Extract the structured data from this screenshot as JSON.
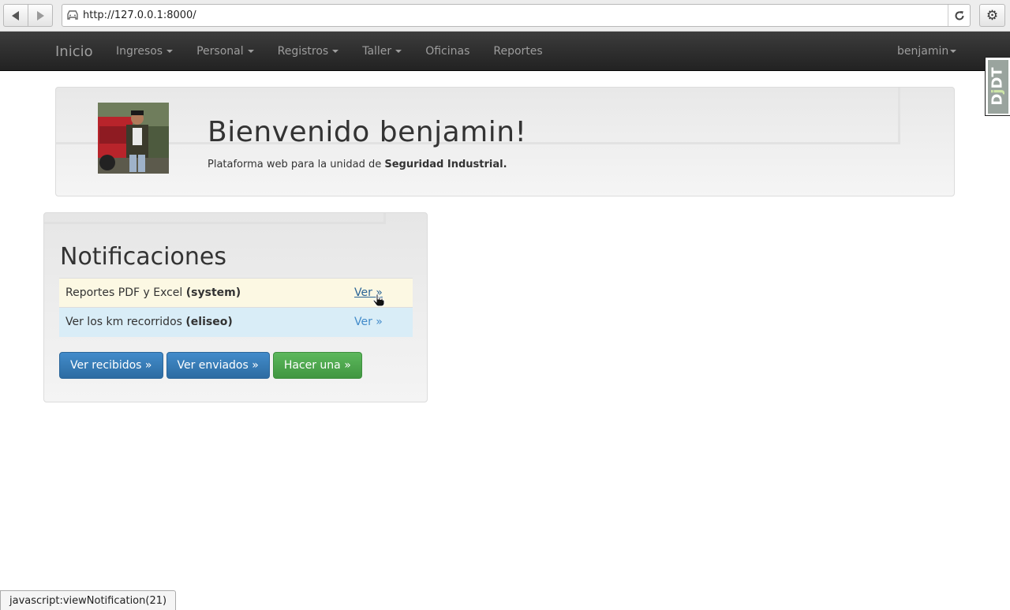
{
  "browser": {
    "url": "http://127.0.0.1:8000/",
    "status_text": "javascript:viewNotification(21)"
  },
  "navbar": {
    "brand": "Inicio",
    "items": [
      {
        "label": "Ingresos",
        "dropdown": true
      },
      {
        "label": "Personal",
        "dropdown": true
      },
      {
        "label": "Registros",
        "dropdown": true
      },
      {
        "label": "Taller",
        "dropdown": true
      },
      {
        "label": "Oficinas",
        "dropdown": false
      },
      {
        "label": "Reportes",
        "dropdown": false
      }
    ],
    "user": "benjamin"
  },
  "debug_toolbar": {
    "label": "DjDT"
  },
  "jumbotron": {
    "title": "Bienvenido benjamin!",
    "subtitle_prefix": "Plataforma web para la unidad de ",
    "subtitle_bold": "Seguridad Industrial."
  },
  "notifications": {
    "heading": "Notificaciones",
    "rows": [
      {
        "text": "Reportes PDF y Excel ",
        "author": "(system)",
        "link": "Ver »",
        "style": "warning"
      },
      {
        "text": "Ver los km recorridos ",
        "author": "(eliseo)",
        "link": "Ver »",
        "style": "info"
      }
    ],
    "buttons": {
      "received": "Ver recibidos »",
      "sent": "Ver enviados »",
      "create": "Hacer una »"
    }
  },
  "colors": {
    "navbar_bg": "#222222",
    "link": "#428bca",
    "primary": "#428bca",
    "success": "#5cb85c",
    "row_warning": "#fcf8e3",
    "row_info": "#d9edf7"
  }
}
